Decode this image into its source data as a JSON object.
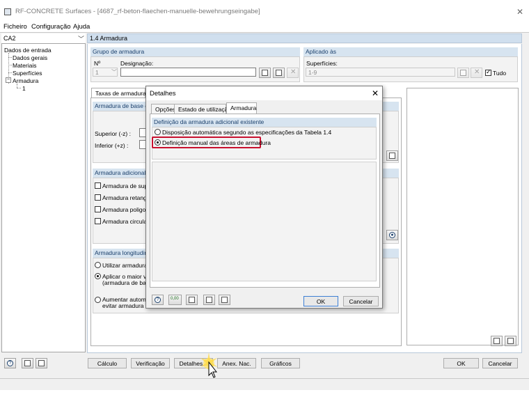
{
  "window": {
    "title": "RF-CONCRETE Surfaces - [4687_rf-beton-flaechen-manuelle-bewehrungseingabe]"
  },
  "menu": [
    "Ficheiro",
    "Configuração",
    "Ajuda"
  ],
  "nav": {
    "case": "CA2",
    "tree": {
      "root": "Dados de entrada",
      "items": [
        "Dados gerais",
        "Materiais",
        "Superfícies"
      ],
      "armadura": "Armadura",
      "sub": "1"
    }
  },
  "section": {
    "title": "1.4 Armadura"
  },
  "grupo": {
    "title": "Grupo de armadura",
    "no_label": "Nº",
    "no_value": "1",
    "designacao_label": "Designação:",
    "designacao_value": ""
  },
  "aplicado": {
    "title": "Aplicado às",
    "superficies_label": "Superfícies:",
    "superficies_value": "1-9",
    "tudo_label": "Tudo",
    "tudo_checked": true
  },
  "tabs": {
    "taxas": "Taxas de armadura"
  },
  "base": {
    "title": "Armadura de base ex",
    "superior": "Superior (-z) :",
    "inferior": "Inferior (+z) :"
  },
  "adicional": {
    "title": "Armadura adicional ex",
    "items": [
      "Armadura de super",
      "Armadura retangul",
      "Armadura poligonal",
      "Armadura circular"
    ]
  },
  "longitudinal": {
    "title": "Armadura longitudinal",
    "opt1": "Utilizar armadura lo",
    "opt2_a": "Aplicar o maior valo",
    "opt2_b": "(armadura de base",
    "opt3_a": "Aumentar automati",
    "opt3_b": "evitar armadura de"
  },
  "dialog": {
    "title": "Detalhes",
    "tabs": [
      "Opções",
      "Estado de utilização",
      "Armadura"
    ],
    "group_title": "Definição da armadura adicional existente",
    "option_auto": "Disposição automática segundo as especificações da Tabela 1.4",
    "option_manual": "Definição manual das áreas de armadura",
    "selected": "manual",
    "decimals_icon_label": "0,00",
    "ok": "OK",
    "cancel": "Cancelar"
  },
  "bottom": {
    "calculo": "Cálculo",
    "verificacao": "Verificação",
    "detalhes": "Detalhes...",
    "anex": "Anex. Nac.",
    "graficos": "Gráficos",
    "ok": "OK",
    "cancel": "Cancelar"
  },
  "colors": {
    "highlight": "#c8102e",
    "section_header": "#d0dfee",
    "group_header": "#d7e4f0",
    "default_button_border": "#3d7fd4"
  }
}
